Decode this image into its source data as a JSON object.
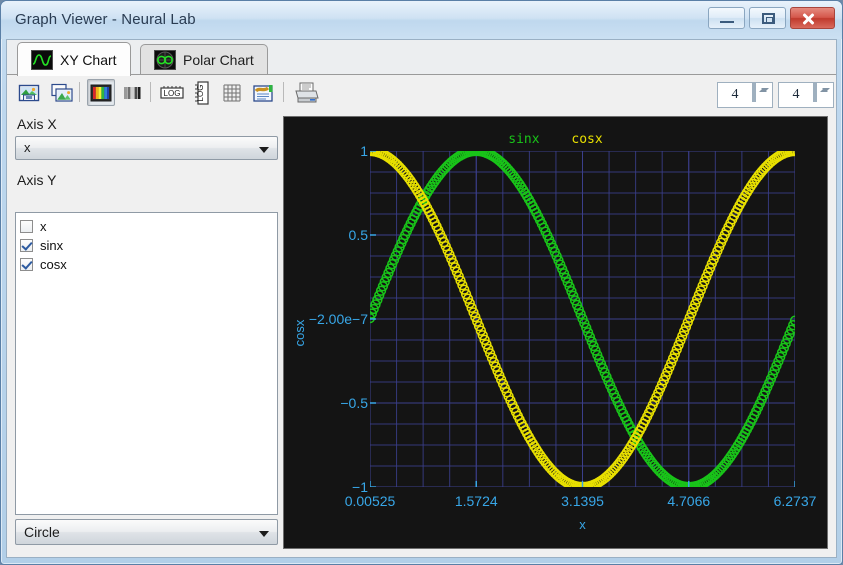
{
  "window": {
    "title": "Graph Viewer - Neural Lab",
    "buttons": {
      "minimize": "minimize",
      "maximize": "restore",
      "close": "close"
    }
  },
  "tabs": [
    {
      "label": "XY Chart",
      "icon": "sine-wave-icon",
      "active": true
    },
    {
      "label": "Polar Chart",
      "icon": "polar-loop-icon",
      "active": false
    }
  ],
  "toolbar": {
    "buttons": [
      {
        "name": "save-image-button",
        "tooltip": "Save image",
        "pressed": false
      },
      {
        "name": "copy-image-button",
        "tooltip": "Copy image",
        "pressed": false
      },
      {
        "name": "color-palette-button",
        "tooltip": "Color",
        "pressed": true
      },
      {
        "name": "grayscale-button",
        "tooltip": "Grayscale",
        "pressed": false
      },
      {
        "name": "log-x-button",
        "tooltip": "LOG X",
        "pressed": false
      },
      {
        "name": "log-y-button",
        "tooltip": "LOG Y",
        "pressed": false
      },
      {
        "name": "grid-button",
        "tooltip": "Grid",
        "pressed": false
      },
      {
        "name": "annotate-button",
        "tooltip": "Edit",
        "pressed": false
      },
      {
        "name": "print-button",
        "tooltip": "Print",
        "pressed": false
      }
    ],
    "spinner_left": "4",
    "spinner_right": "4"
  },
  "sidebar": {
    "axis_x_label": "Axis X",
    "axis_x_value": "x",
    "axis_y_label": "Axis Y",
    "series": [
      {
        "label": "x",
        "checked": false
      },
      {
        "label": "sinx",
        "checked": true
      },
      {
        "label": "cosx",
        "checked": true
      }
    ],
    "marker_value": "Circle"
  },
  "chart_data": {
    "type": "scatter",
    "title": "",
    "xlabel": "x",
    "ylabel": "cosx",
    "grid": true,
    "legend_position": "top-center",
    "marker": "Circle",
    "background": "#141414",
    "grid_color": "#3b3f8c",
    "tick_color": "#38a7e8",
    "xlim": [
      0.00525,
      6.2737
    ],
    "ylim": [
      -1,
      1
    ],
    "xticks": [
      "0.00525",
      "1.5724",
      "3.1395",
      "4.7066",
      "6.2737"
    ],
    "xtick_values": [
      0.00525,
      1.5724,
      3.1395,
      4.7066,
      6.2737
    ],
    "yticks": [
      "1",
      "0.5",
      "−2.00e−7",
      "−0.5",
      "−1"
    ],
    "ytick_values": [
      1,
      0.5,
      -2e-07,
      -0.5,
      -1
    ],
    "series": [
      {
        "name": "sinx",
        "color": "#19c419",
        "function": "sin(x)",
        "x": [
          0.00525,
          0.3,
          0.6,
          0.9,
          1.2,
          1.5708,
          1.9,
          2.3,
          2.7,
          3.1395,
          3.5,
          3.9,
          4.3,
          4.7066,
          5.1,
          5.5,
          5.9,
          6.2737
        ],
        "values": [
          0.00525,
          0.2955,
          0.5646,
          0.7833,
          0.932,
          1.0,
          0.9463,
          0.7457,
          0.4274,
          0.0021,
          -0.3508,
          -0.6878,
          -0.9162,
          -1.0,
          -0.9258,
          -0.7055,
          -0.3739,
          -0.00949
        ]
      },
      {
        "name": "cosx",
        "color": "#e8e000",
        "function": "cos(x)",
        "x": [
          0.00525,
          0.3,
          0.6,
          0.9,
          1.2,
          1.5708,
          1.9,
          2.3,
          2.7,
          3.1395,
          3.5,
          3.9,
          4.3,
          4.7066,
          5.1,
          5.5,
          5.9,
          6.2737
        ],
        "values": [
          1.0,
          0.9553,
          0.8253,
          0.6216,
          0.3624,
          0.0,
          -0.323,
          -0.6663,
          -0.904,
          -1.0,
          -0.9365,
          -0.7259,
          -0.4008,
          0.0021,
          0.378,
          0.7087,
          0.9275,
          0.99995
        ]
      }
    ]
  }
}
